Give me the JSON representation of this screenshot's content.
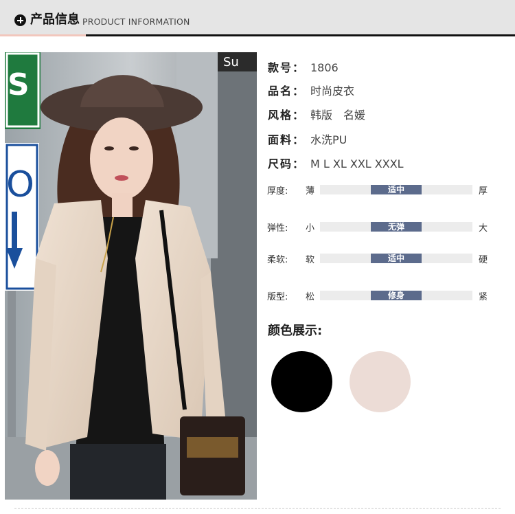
{
  "header": {
    "title_cn": "产品信息",
    "title_en": "PRODUCT INFORMATION"
  },
  "specs": [
    {
      "label": "款号：",
      "value": "1806"
    },
    {
      "label": "品名：",
      "value": "时尚皮衣"
    },
    {
      "label": "风格：",
      "value": "韩版　名媛"
    },
    {
      "label": "面料：",
      "value": "水洗PU"
    },
    {
      "label": "尺码：",
      "value": "M L XL XXL XXXL"
    }
  ],
  "meters": [
    {
      "label": "厚度:",
      "low": "薄",
      "selected": "适中",
      "high": "厚",
      "level": 0.5
    },
    {
      "label": "弹性:",
      "low": "小",
      "selected": "无弹",
      "high": "大",
      "level": 0.5
    },
    {
      "label": "柔软:",
      "low": "软",
      "selected": "适中",
      "high": "硬",
      "level": 0.5
    },
    {
      "label": "版型:",
      "low": "松",
      "selected": "修身",
      "high": "紧",
      "level": 0.5
    }
  ],
  "colors_title": "颜色展示:",
  "color_swatches": [
    {
      "name": "black",
      "hex": "#000000"
    },
    {
      "name": "beige",
      "hex": "#ecdcd6"
    }
  ],
  "photo": {
    "sign_text_top": "S",
    "sign_text_mid": "O",
    "sign_text_right": "Su"
  }
}
